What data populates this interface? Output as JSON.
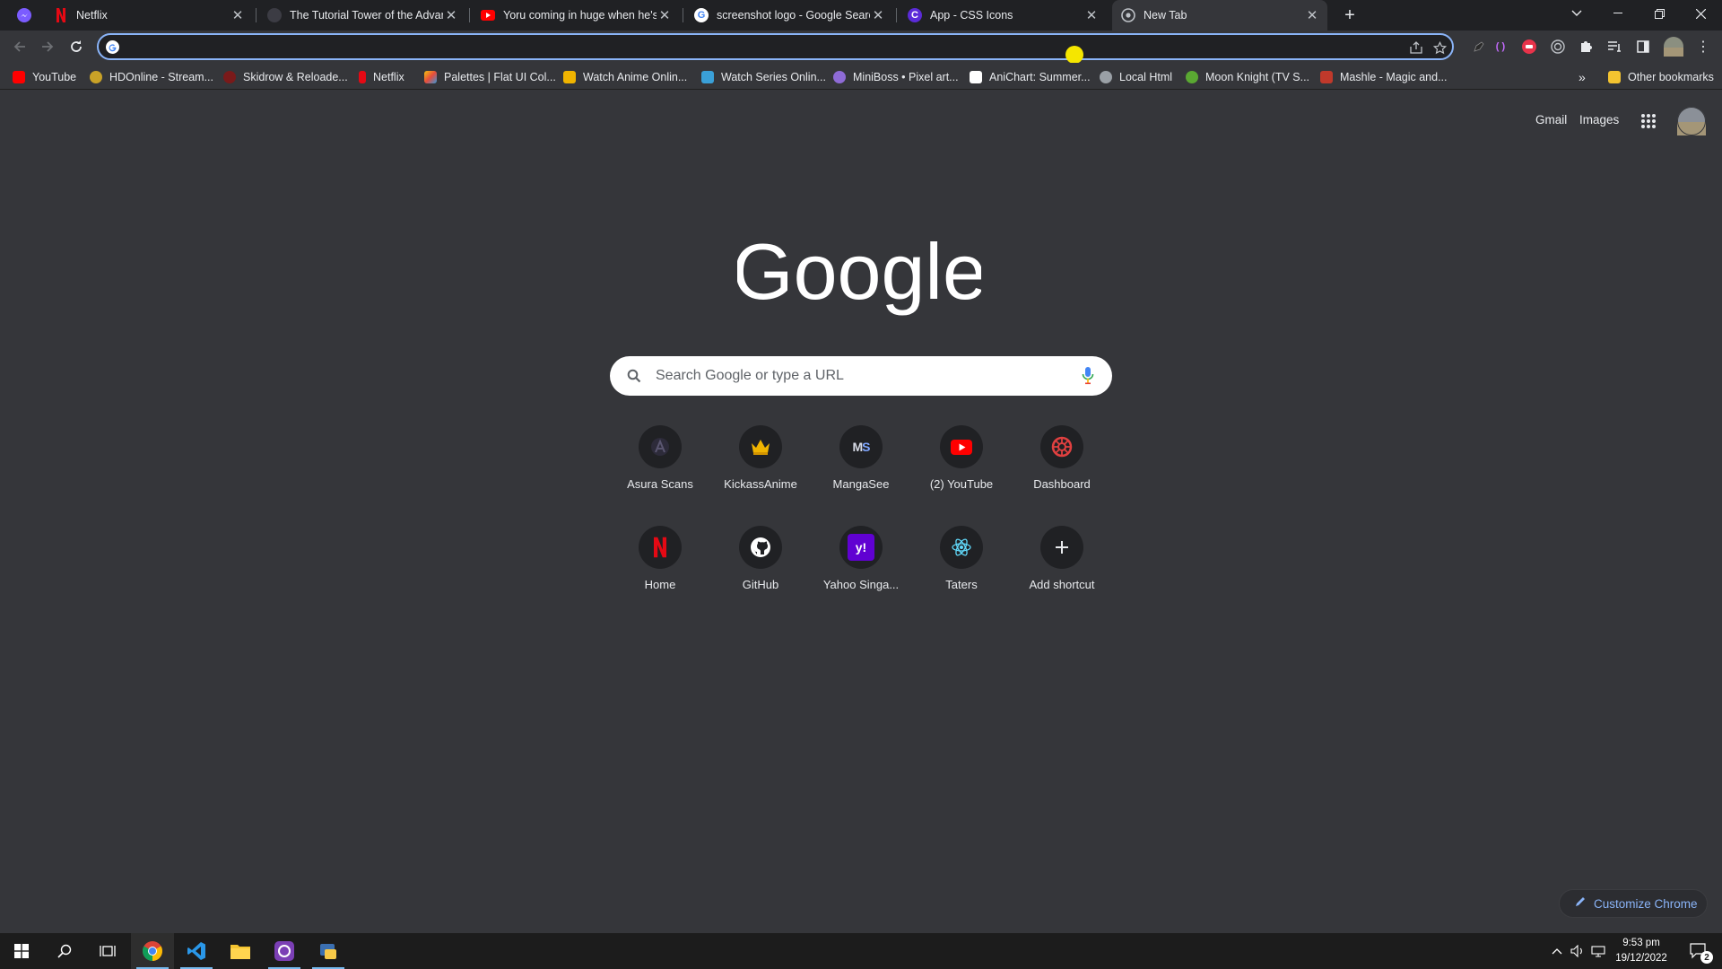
{
  "tabs": [
    {
      "title": "Netflix",
      "icon": "netflix-icon"
    },
    {
      "title": "The Tutorial Tower of the Advanced",
      "icon": "site-icon"
    },
    {
      "title": "Yoru coming in huge when he's n",
      "icon": "youtube-icon"
    },
    {
      "title": "screenshot logo - Google Search",
      "icon": "google-icon"
    },
    {
      "title": "App - CSS Icons",
      "icon": "css-icons-icon"
    },
    {
      "title": "New Tab",
      "icon": "chrome-icon"
    }
  ],
  "omnibox": {
    "value": "",
    "placeholder": ""
  },
  "bookmarks": [
    {
      "label": "YouTube",
      "color": "#ff0000"
    },
    {
      "label": "HDOnline - Stream...",
      "color": "#c9a227"
    },
    {
      "label": "Skidrow & Reloade...",
      "color": "#7a1a1a"
    },
    {
      "label": "Netflix",
      "color": "#e50914"
    },
    {
      "label": "Palettes | Flat UI Col...",
      "color": "#f1c40f"
    },
    {
      "label": "Watch Anime Onlin...",
      "color": "#f0b400"
    },
    {
      "label": "Watch Series Onlin...",
      "color": "#3aa0d8"
    },
    {
      "label": "MiniBoss • Pixel art...",
      "color": "#8e6bd6"
    },
    {
      "label": "AniChart: Summer...",
      "color": "#ffffff"
    },
    {
      "label": "Local Html",
      "color": "#9aa0a6"
    },
    {
      "label": "Moon Knight (TV S...",
      "color": "#5aa832"
    },
    {
      "label": "Mashle - Magic and...",
      "color": "#c0392b"
    }
  ],
  "other_bookmarks": "Other bookmarks",
  "ntp": {
    "gmail": "Gmail",
    "images": "Images",
    "logo_text": "Google",
    "search_placeholder": "Search Google or type a URL",
    "customize": "Customize Chrome"
  },
  "shortcuts": [
    {
      "label": "Asura Scans",
      "icon": "asura-icon"
    },
    {
      "label": "KickassAnime",
      "icon": "crown-icon"
    },
    {
      "label": "MangaSee",
      "icon": "mangasee-icon"
    },
    {
      "label": "(2) YouTube",
      "icon": "youtube-icon"
    },
    {
      "label": "Dashboard",
      "icon": "dashboard-icon"
    },
    {
      "label": "Home",
      "icon": "netflix-icon"
    },
    {
      "label": "GitHub",
      "icon": "github-icon"
    },
    {
      "label": "Yahoo Singa...",
      "icon": "yahoo-icon"
    },
    {
      "label": "Taters",
      "icon": "react-icon"
    },
    {
      "label": "Add shortcut",
      "icon": "plus-icon"
    }
  ],
  "taskbar": {
    "time": "9:53 pm",
    "date": "19/12/2022",
    "notification_count": "2"
  },
  "colors": {
    "accent": "#8ab4f8",
    "background": "#35363a",
    "tabstrip": "#202124"
  }
}
